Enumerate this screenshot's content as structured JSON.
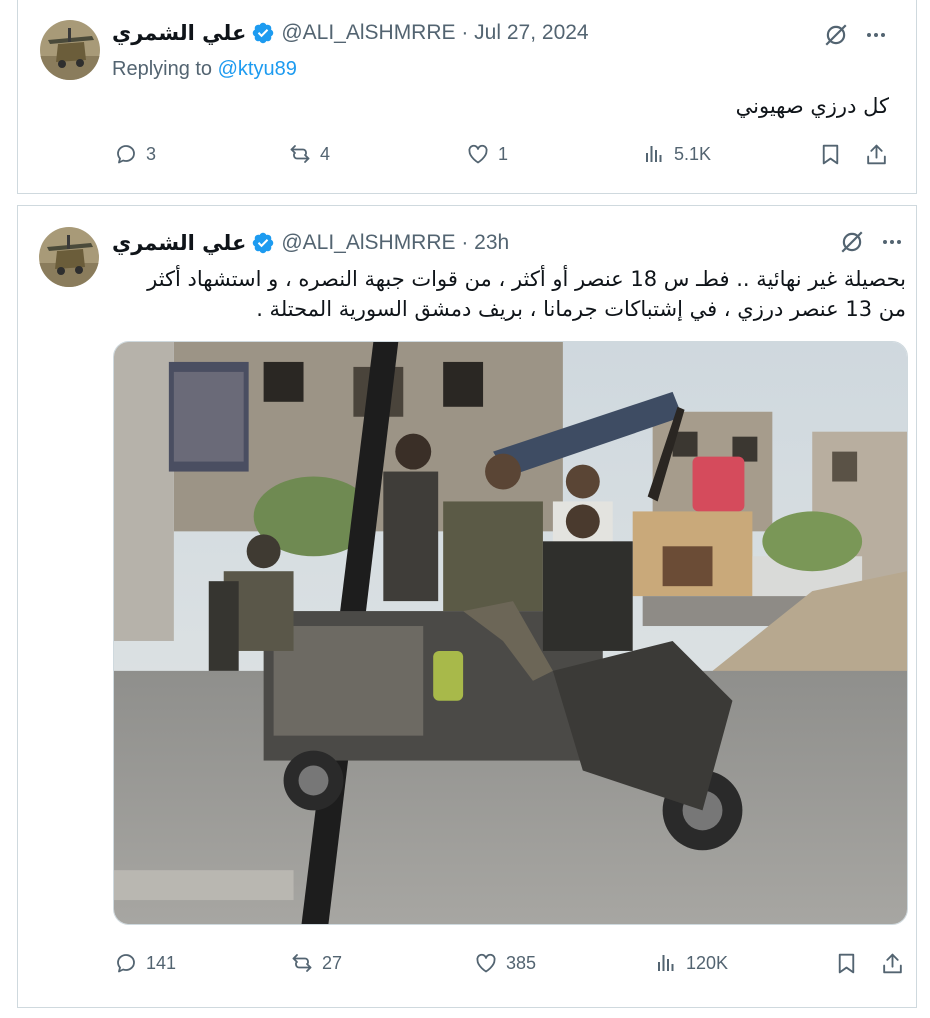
{
  "tweet1": {
    "display_name": "علي الشمري",
    "handle_date": "@ALI_AlSHMRRE · Jul 27, 2024",
    "replying_prefix": "Replying to ",
    "replying_to": "@ktyu89",
    "text": "كل درزي صهيوني",
    "replies": "3",
    "reposts": "4",
    "likes": "1",
    "views": "5.1K"
  },
  "tweet2": {
    "display_name": "علي الشمري",
    "handle_date": "@ALI_AlSHMRRE · 23h",
    "text_line1": "بحصيلة غير نهائية .. فطـ س 18 عنصر أو أكثر ، من قوات جبهة النصره ، و استشهاد أكثر",
    "text_line2": "من 13 عنصر درزي ، في إشتباكات جرمانا ، بريف دمشق السورية المحتلة .",
    "replies": "141",
    "reposts": "27",
    "likes": "385",
    "views": "120K"
  },
  "colors": {
    "text": "#0f1419",
    "secondary": "#536471",
    "accent": "#1d9bf0",
    "border": "#cfd9de"
  },
  "icons": [
    "avatar",
    "verified-badge-icon",
    "grok-icon",
    "more-icon",
    "reply-icon",
    "repost-icon",
    "like-icon",
    "views-icon",
    "bookmark-icon",
    "share-icon"
  ]
}
